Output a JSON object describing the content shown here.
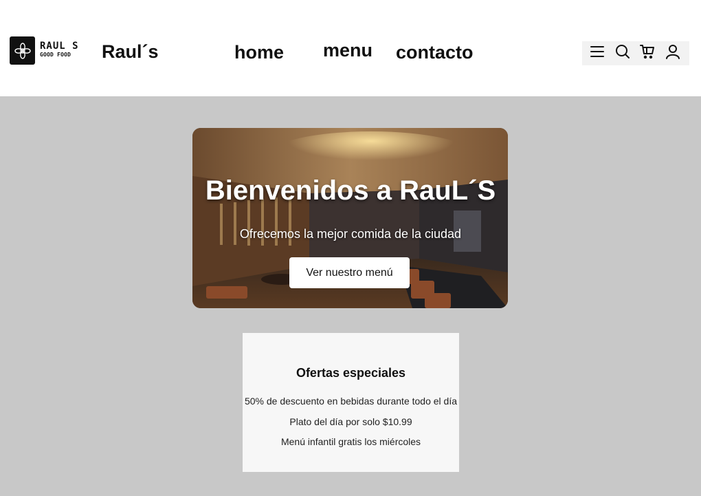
{
  "header": {
    "logo": {
      "title": "RAUL S",
      "subtitle": "GOOD FOOD"
    },
    "brand": "Raul´s",
    "nav": {
      "home": "home",
      "menu": "menu",
      "contact": "contacto"
    },
    "icons": [
      "menu-icon",
      "search-icon",
      "cart-icon",
      "user-icon"
    ]
  },
  "hero": {
    "title": "Bienvenidos a RauL´S",
    "subtitle": "Ofrecemos la mejor comida de la ciudad",
    "button_label": "Ver nuestro menú"
  },
  "offers": {
    "title": "Ofertas especiales",
    "items": [
      "50% de descuento en bebidas durante todo el día",
      "Plato del día por solo $10.99",
      "Menú infantil gratis los miércoles"
    ]
  },
  "colors": {
    "page_background": "#c8c8c8",
    "header_background": "#ffffff",
    "offers_background": "#f7f7f7",
    "text": "#111111"
  }
}
